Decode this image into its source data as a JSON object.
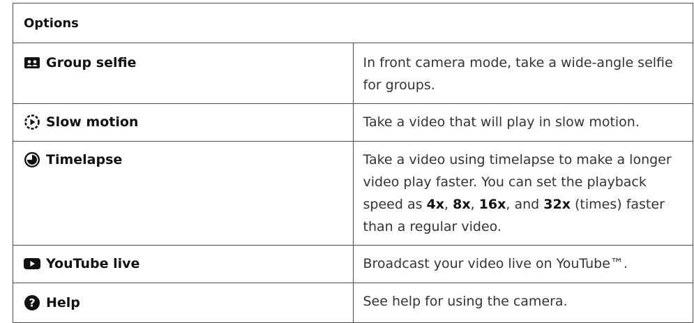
{
  "header": {
    "title": "Options"
  },
  "options": [
    {
      "name": "Group selfie",
      "icon": "group-selfie-icon",
      "description": "In front camera mode, take a wide-angle selfie for groups."
    },
    {
      "name": "Slow motion",
      "icon": "slow-motion-icon",
      "description": "Take a video that will play in slow motion."
    },
    {
      "name": "Timelapse",
      "icon": "timelapse-icon",
      "description_parts": [
        "Take a video using timelapse to make a longer video play faster. You can set the playback speed as ",
        "4x",
        ", ",
        "8x",
        ", ",
        "16x",
        ", and ",
        "32x",
        " (times) faster than a regular video."
      ]
    },
    {
      "name": "YouTube live",
      "icon": "youtube-icon",
      "description": "Broadcast your video live on YouTube™."
    },
    {
      "name": "Help",
      "icon": "help-icon",
      "description": "See help for using the camera."
    }
  ]
}
